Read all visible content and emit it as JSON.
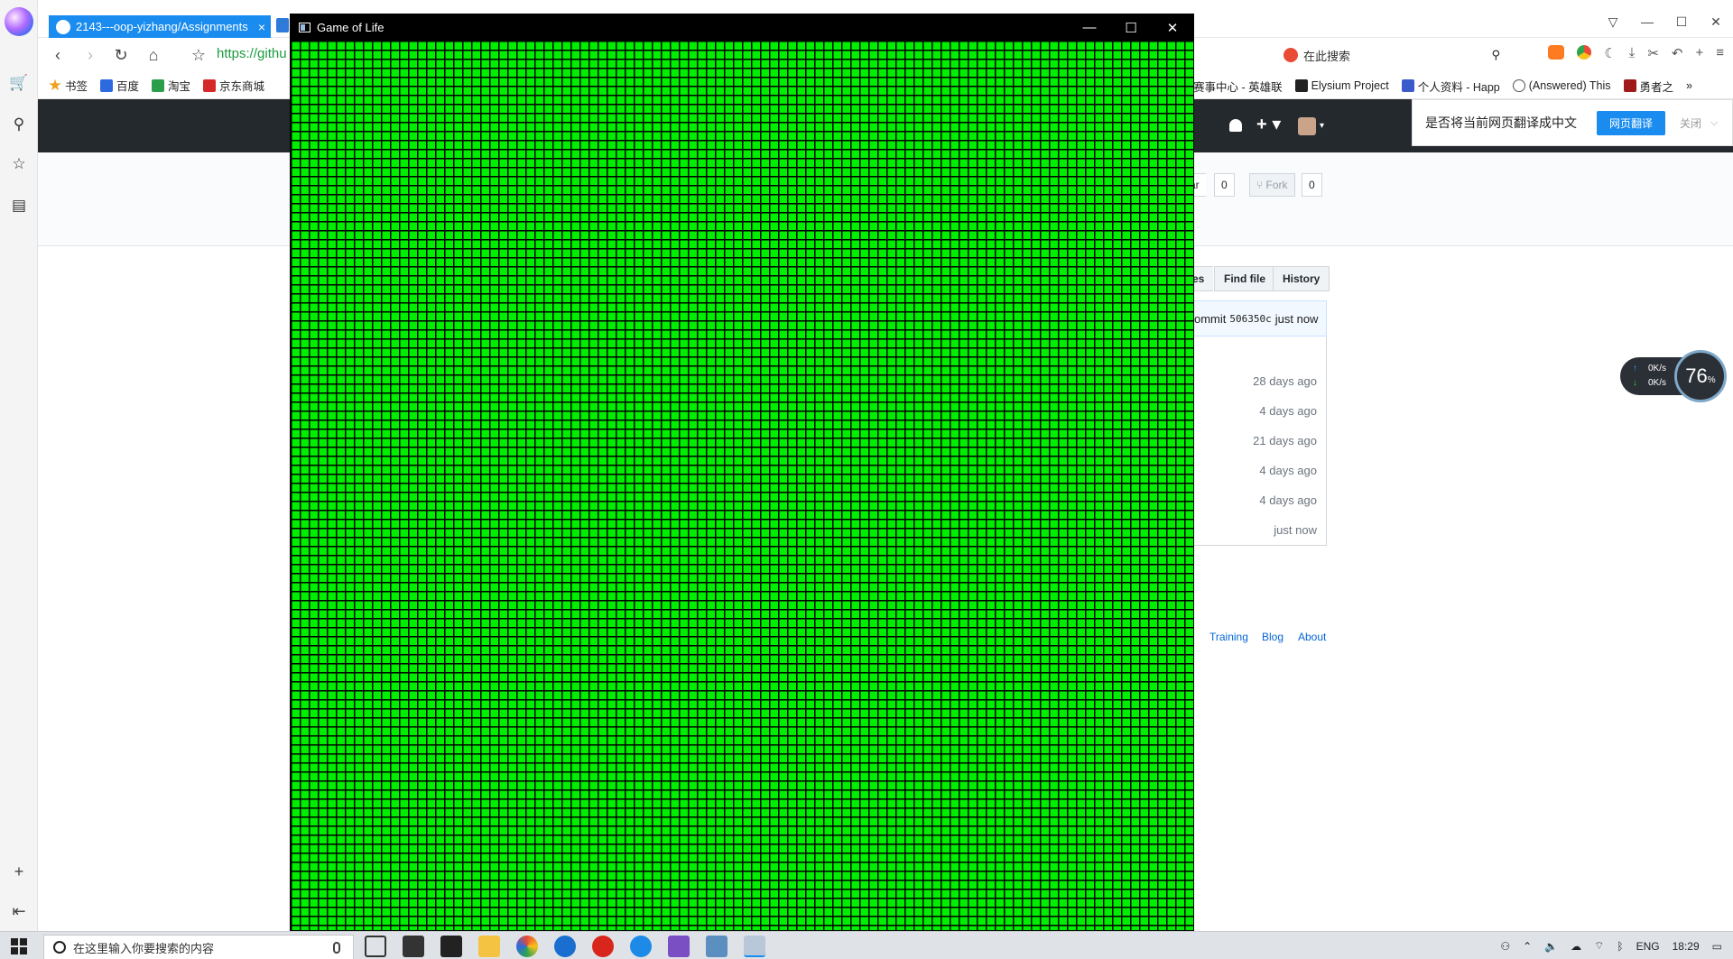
{
  "browser": {
    "active_tab": {
      "title": "2143---oop-yizhang/Assignments",
      "close": "×"
    },
    "url": "https://githu",
    "search_placeholder": "在此搜索",
    "window_controls": {
      "menu": "▽",
      "minimize": "—",
      "maximize": "☐",
      "close": "✕"
    },
    "nav": {
      "back": "‹",
      "forward": "›",
      "reload": "↻",
      "home": "⌂",
      "star": "☆"
    },
    "bookmarks": [
      {
        "label": "书签",
        "color": "#f0a020"
      },
      {
        "label": "百度",
        "color": "#2d6ae0"
      },
      {
        "label": "淘宝",
        "color": "#2a9e4a"
      },
      {
        "label": "京东商城",
        "color": "#d62a2a"
      },
      {
        "label": "赛事中心 - 英雄联",
        "color": "#ffffff"
      },
      {
        "label": "Elysium Project",
        "color": "#222222"
      },
      {
        "label": "个人资料 - Happ",
        "color": "#3b5bcc"
      },
      {
        "label": "(Answered) This",
        "color": "#ffffff"
      },
      {
        "label": "勇者之",
        "color": "#a01a1a"
      }
    ],
    "more_bookmarks": "»"
  },
  "translate_bar": {
    "prompt": "是否将当前网页翻译成中文",
    "button": "网页翻译",
    "close": "关闭",
    "dropdown": "⌵"
  },
  "github": {
    "star_label": "ar",
    "star_count": "0",
    "fork_label": "Fork",
    "fork_count": "0",
    "file_buttons": {
      "partial": "es",
      "find_file": "Find file",
      "history": "History"
    },
    "commit": {
      "prefix": "ommit",
      "hash": "506350c",
      "time": "just now"
    },
    "file_ages": [
      "28 days ago",
      "4 days ago",
      "21 days ago",
      "4 days ago",
      "4 days ago",
      "just now"
    ],
    "footer_links": [
      "Training",
      "Blog",
      "About"
    ]
  },
  "speed_widget": {
    "upload": "0K/s",
    "download": "0K/s",
    "percent": "76",
    "percent_unit": "%"
  },
  "gol_window": {
    "title": "Game of Life",
    "controls": {
      "minimize": "—",
      "maximize": "☐",
      "close": "✕"
    },
    "cell_color": "#00ee00",
    "grid_color": "#000000"
  },
  "taskbar": {
    "search_placeholder": "在这里输入你要搜索的内容",
    "language": "ENG",
    "time": "18:29"
  }
}
